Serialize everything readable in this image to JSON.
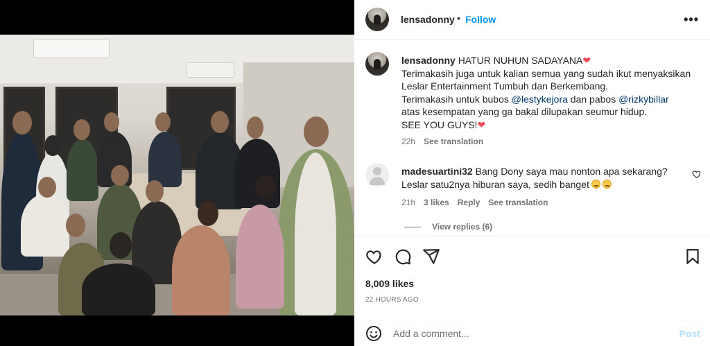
{
  "post": {
    "username": "lensadonny",
    "separator": "•",
    "follow_label": "Follow",
    "more_label": "•••"
  },
  "caption": {
    "username": "lensadonny",
    "line1": "HATUR NUHUN SADAYANA",
    "line2": "Terimakasih juga untuk kalian semua yang sudah ikut menyaksikan Leslar Entertainment Tumbuh dan Berkembang.",
    "line3a": "Terimakasih untuk bubos ",
    "mention1": "@lestykejora",
    "line3b": " dan pabos ",
    "mention2": "@rizkybillar",
    "line4": "atas kesempatan yang ga bakal dilupakan seumur hidup.",
    "line5": "SEE YOU GUYS!",
    "heart": "❤",
    "time": "22h",
    "see_translation": "See translation"
  },
  "comment": {
    "username": "madesuartini32",
    "text": "Bang Dony saya mau nonton apa sekarang? Leslar satu2nya hiburan saya, sedih banget",
    "time": "21h",
    "likes": "3 likes",
    "reply": "Reply",
    "see_translation": "See translation",
    "view_replies": "View replies (6)"
  },
  "actions": {
    "likes": "8,009 likes",
    "timestamp": "22 HOURS AGO"
  },
  "composer": {
    "placeholder": "Add a comment...",
    "post_label": "Post"
  },
  "colors": {
    "link": "#0095f6",
    "mention": "#00376b",
    "muted": "#737373",
    "heart": "#ed4956"
  },
  "icons": [
    "heart-icon",
    "comment-icon",
    "share-icon",
    "bookmark-icon",
    "emoji-icon",
    "more-icon"
  ]
}
